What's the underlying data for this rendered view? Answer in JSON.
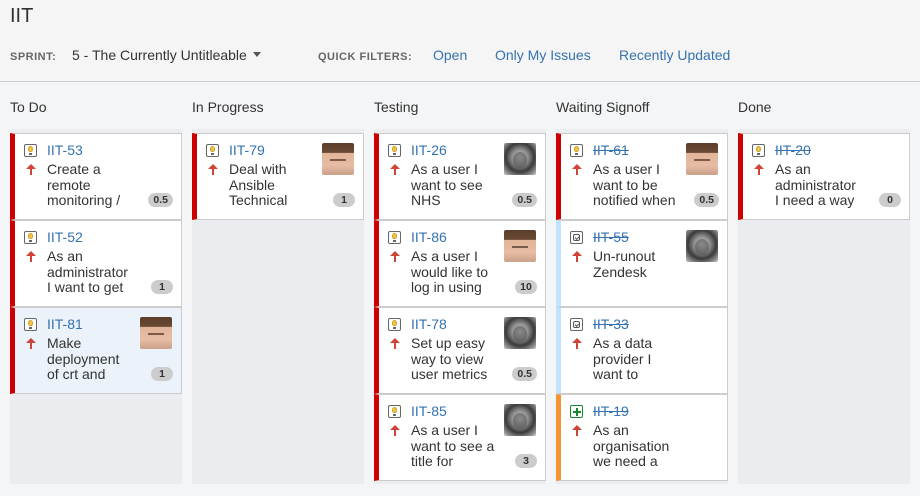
{
  "board": {
    "title": "IIT"
  },
  "header": {
    "sprint_label": "SPRINT:",
    "sprint_value": "5 - The Currently Untitleable",
    "quick_filters_label": "QUICK FILTERS:",
    "quick_filters": [
      "Open",
      "Only My Issues",
      "Recently Updated"
    ]
  },
  "columns": [
    {
      "name": "To Do",
      "cards": [
        {
          "key": "IIT-53",
          "type": "story",
          "summary": "Create a\nremote\nmonitoring /",
          "estimate": "0.5",
          "avatar": "none",
          "resolved": false
        },
        {
          "key": "IIT-52",
          "type": "story",
          "summary": "As an\nadministrator\nI want to get",
          "estimate": "1",
          "avatar": "none",
          "resolved": false
        },
        {
          "key": "IIT-81",
          "type": "story",
          "summary": "Make\ndeployment\nof crt and",
          "estimate": "1",
          "avatar": "user-a",
          "resolved": false
        }
      ]
    },
    {
      "name": "In Progress",
      "cards": [
        {
          "key": "IIT-79",
          "type": "story",
          "summary": "Deal with\nAnsible\nTechnical",
          "estimate": "1",
          "avatar": "user-a",
          "resolved": false
        }
      ]
    },
    {
      "name": "Testing",
      "cards": [
        {
          "key": "IIT-26",
          "type": "story",
          "summary": "As a user I\nwant to see\nNHS",
          "estimate": "0.5",
          "avatar": "user-b",
          "resolved": false
        },
        {
          "key": "IIT-86",
          "type": "story",
          "summary": "As a user I\nwould like to\nlog in using",
          "estimate": "10",
          "avatar": "user-a",
          "resolved": false
        },
        {
          "key": "IIT-78",
          "type": "story",
          "summary": "Set up easy\nway to view\nuser metrics",
          "estimate": "0.5",
          "avatar": "user-b",
          "resolved": false
        },
        {
          "key": "IIT-85",
          "type": "story",
          "summary": "As a user I\nwant to see a\ntitle for",
          "estimate": "3",
          "avatar": "user-b",
          "resolved": false
        }
      ]
    },
    {
      "name": "Waiting Signoff",
      "cards": [
        {
          "key": "IIT-61",
          "type": "story",
          "summary": "As a user I\nwant to be\nnotified when",
          "estimate": "0.5",
          "avatar": "user-a",
          "resolved": true
        },
        {
          "key": "IIT-55",
          "type": "task",
          "summary": "Un-runout\nZendesk",
          "estimate": "",
          "avatar": "user-b",
          "resolved": true
        },
        {
          "key": "IIT-33",
          "type": "task",
          "summary": "As a data\nprovider I\nwant to",
          "estimate": "",
          "avatar": "none",
          "resolved": true
        },
        {
          "key": "IIT-19",
          "type": "new-feature",
          "summary": "As an\norganisation\nwe need a",
          "estimate": "",
          "avatar": "none",
          "resolved": true
        }
      ]
    },
    {
      "name": "Done",
      "cards": [
        {
          "key": "IIT-20",
          "type": "story",
          "summary": "As an\nadministrator\nI need a way",
          "estimate": "0",
          "avatar": "none",
          "resolved": true
        }
      ]
    }
  ],
  "colors": {
    "link": "#3572b0",
    "high_priority": "#d04437",
    "card_edge_red": "#c00",
    "card_edge_blue": "#bfe4ff",
    "card_edge_orange": "#f79232",
    "badge": "#cccccc"
  }
}
